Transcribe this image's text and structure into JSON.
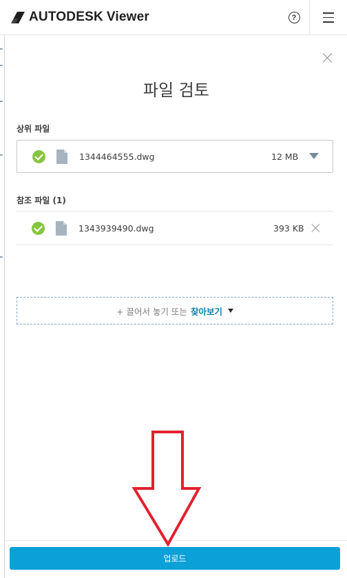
{
  "header": {
    "brand": "AUTODESK",
    "product": "Viewer",
    "help_symbol": "?"
  },
  "dialog": {
    "title": "파일 검토",
    "parent_section_label": "상위 파일",
    "parent_file": {
      "name": "1344464555.dwg",
      "size": "12 MB",
      "status_icon": "check-circle-icon",
      "file_icon": "document-icon"
    },
    "reference_section_label": "참조 파일 (1)",
    "reference_files": [
      {
        "name": "1343939490.dwg",
        "size": "393 KB",
        "status_icon": "check-circle-icon",
        "file_icon": "document-icon"
      }
    ],
    "dropzone": {
      "text": "+ 끌어서 놓기 또는",
      "browse_label": "찾아보기"
    },
    "upload_label": "업로드"
  },
  "colors": {
    "accent": "#0ca0d9",
    "browse_link": "#0c7fb0",
    "check_green": "#87c540",
    "annotation_red": "#e3202e"
  }
}
